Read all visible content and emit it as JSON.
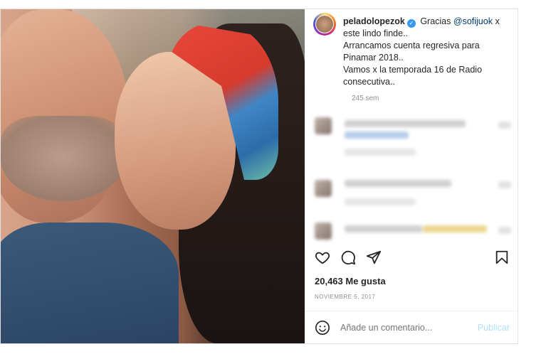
{
  "post": {
    "username": "peladolopezok",
    "verified_badge": "✓",
    "caption_prefix": "Gracias",
    "mention": "@sofijuok",
    "caption_lines": [
      "x",
      "este lindo finde..",
      "Arrancamos cuenta regresiva para",
      "Pinamar 2018..",
      "Vamos x la temporada 16 de Radio",
      "consecutiva.."
    ],
    "time_ago": "245 sem",
    "likes": "20,463 Me gusta",
    "date": "NOVIEMBRE 5, 2017"
  },
  "actions": {
    "like_icon": "heart-icon",
    "comment_icon": "comment-icon",
    "share_icon": "share-icon",
    "save_icon": "bookmark-icon"
  },
  "comment_box": {
    "placeholder": "Añade un comentario...",
    "publish_label": "Publicar",
    "emoji_icon": "emoji-icon"
  },
  "colors": {
    "link": "#00376b",
    "verified": "#3897f0",
    "publish_disabled": "#b2dffc",
    "muted": "#8e8e8e"
  }
}
